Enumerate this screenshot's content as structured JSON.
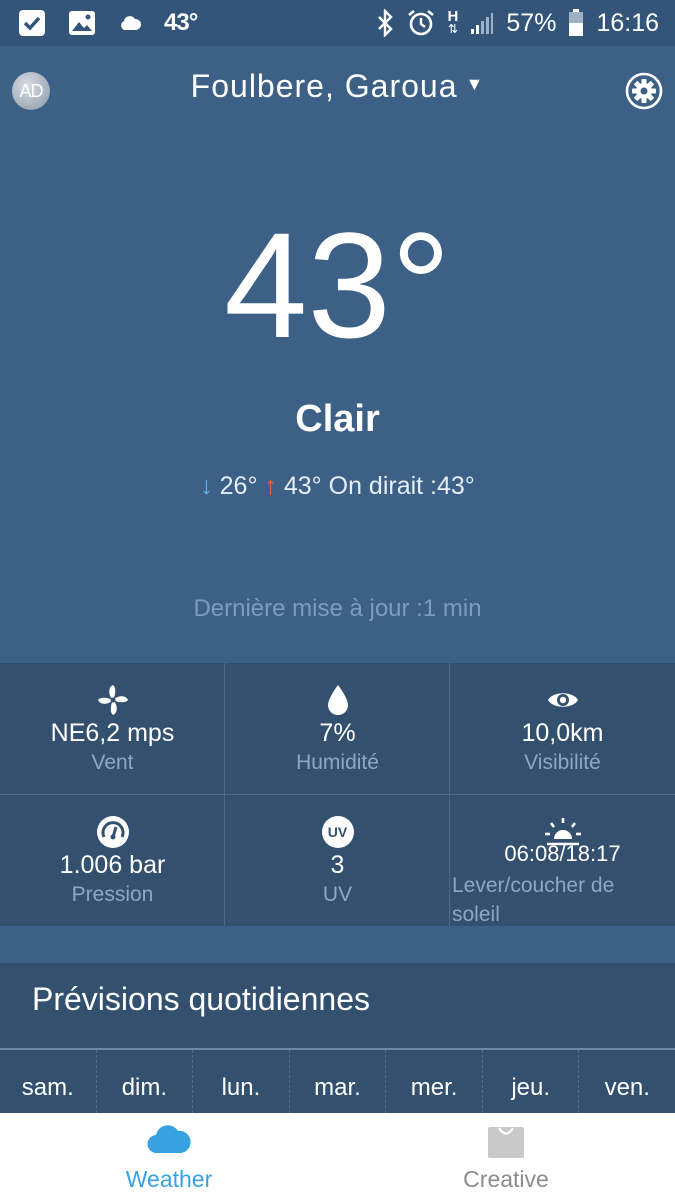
{
  "status_bar": {
    "temperature": "43°",
    "network": "H",
    "battery": "57%",
    "time": "16:16"
  },
  "header": {
    "ad_badge": "AD",
    "location": "Foulbere, Garoua",
    "caret": "▼"
  },
  "current": {
    "temperature": "43°",
    "condition": "Clair",
    "low": "26°",
    "high": "43°",
    "feels_like": "On dirait :43°",
    "arrow_down": "↓",
    "arrow_up": "↑",
    "updated": "Dernière mise à jour :1 min"
  },
  "details": [
    {
      "value": "NE6,2 mps",
      "label": "Vent",
      "icon": "fan-icon"
    },
    {
      "value": "7%",
      "label": "Humidité",
      "icon": "droplet-icon"
    },
    {
      "value": "10,0km",
      "label": "Visibilité",
      "icon": "eye-icon"
    },
    {
      "value": "1.006 bar",
      "label": "Pression",
      "icon": "gauge-icon"
    },
    {
      "value": "3",
      "label": "UV",
      "icon": "uv-icon",
      "icon_text": "UV"
    },
    {
      "value": "06:08/18:17",
      "label": "Lever/coucher de soleil",
      "icon": "sunrise-icon"
    }
  ],
  "daily": {
    "title": "Prévisions quotidiennes",
    "days": [
      "sam.",
      "dim.",
      "lun.",
      "mar.",
      "mer.",
      "jeu.",
      "ven."
    ]
  },
  "bottom_nav": {
    "weather_label": "Weather",
    "creative_label": "Creative",
    "active_color": "#36a3e0",
    "inactive_color": "#8c8c8c"
  }
}
